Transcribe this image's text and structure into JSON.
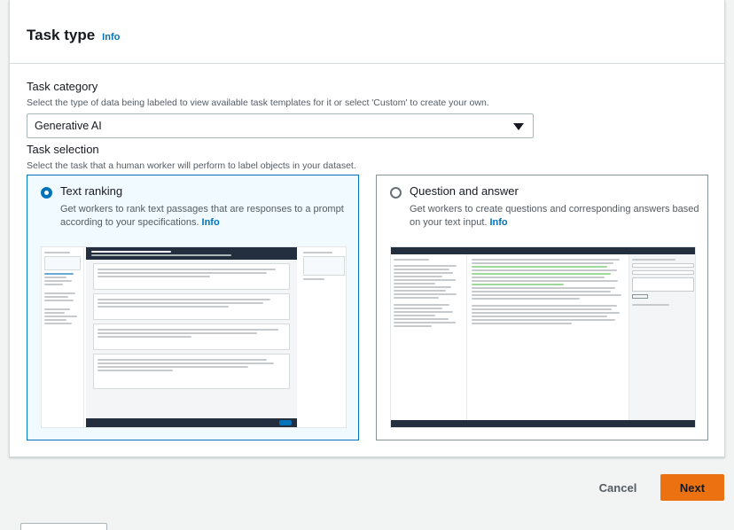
{
  "section": {
    "title": "Task type",
    "info_label": "Info"
  },
  "task_category": {
    "label": "Task category",
    "description": "Select the type of data being labeled to view available task templates for it or select 'Custom' to create your own.",
    "selected_value": "Generative AI"
  },
  "task_selection": {
    "label": "Task selection",
    "description": "Select the task that a human worker will perform to label objects in your dataset.",
    "options": [
      {
        "title": "Text ranking",
        "description": "Get workers to rank text passages that are responses to a prompt according to your specifications.",
        "info_label": "Info",
        "selected": true
      },
      {
        "title": "Question and answer",
        "description": "Get workers to create questions and corresponding answers based on your text input.",
        "info_label": "Info",
        "selected": false
      }
    ]
  },
  "actions": {
    "cancel_label": "Cancel",
    "next_label": "Next"
  },
  "colors": {
    "accent": "#0073bb",
    "primary_button": "#ec7211",
    "selected_tile_bg": "#f1faff"
  }
}
